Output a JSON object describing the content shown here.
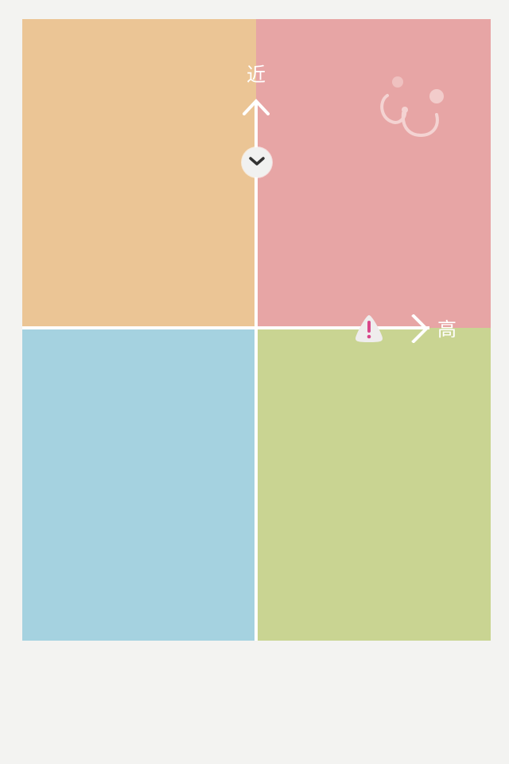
{
  "axes": {
    "vertical_label": "近",
    "horizontal_label": "高"
  },
  "quadrants": [
    {
      "id": "top-left",
      "color": "#ebc595"
    },
    {
      "id": "top-right",
      "color": "#e7a5a5"
    },
    {
      "id": "bottom-left",
      "color": "#a5d2e0"
    },
    {
      "id": "bottom-right",
      "color": "#c9d492"
    }
  ],
  "icons": {
    "clock": "chevron-down-icon",
    "alert": "warning-icon",
    "decoration": "face-doodle-icon"
  },
  "colors": {
    "background": "#f3f3f1",
    "axis": "#ffffff",
    "alert_accent": "#d8478a"
  }
}
